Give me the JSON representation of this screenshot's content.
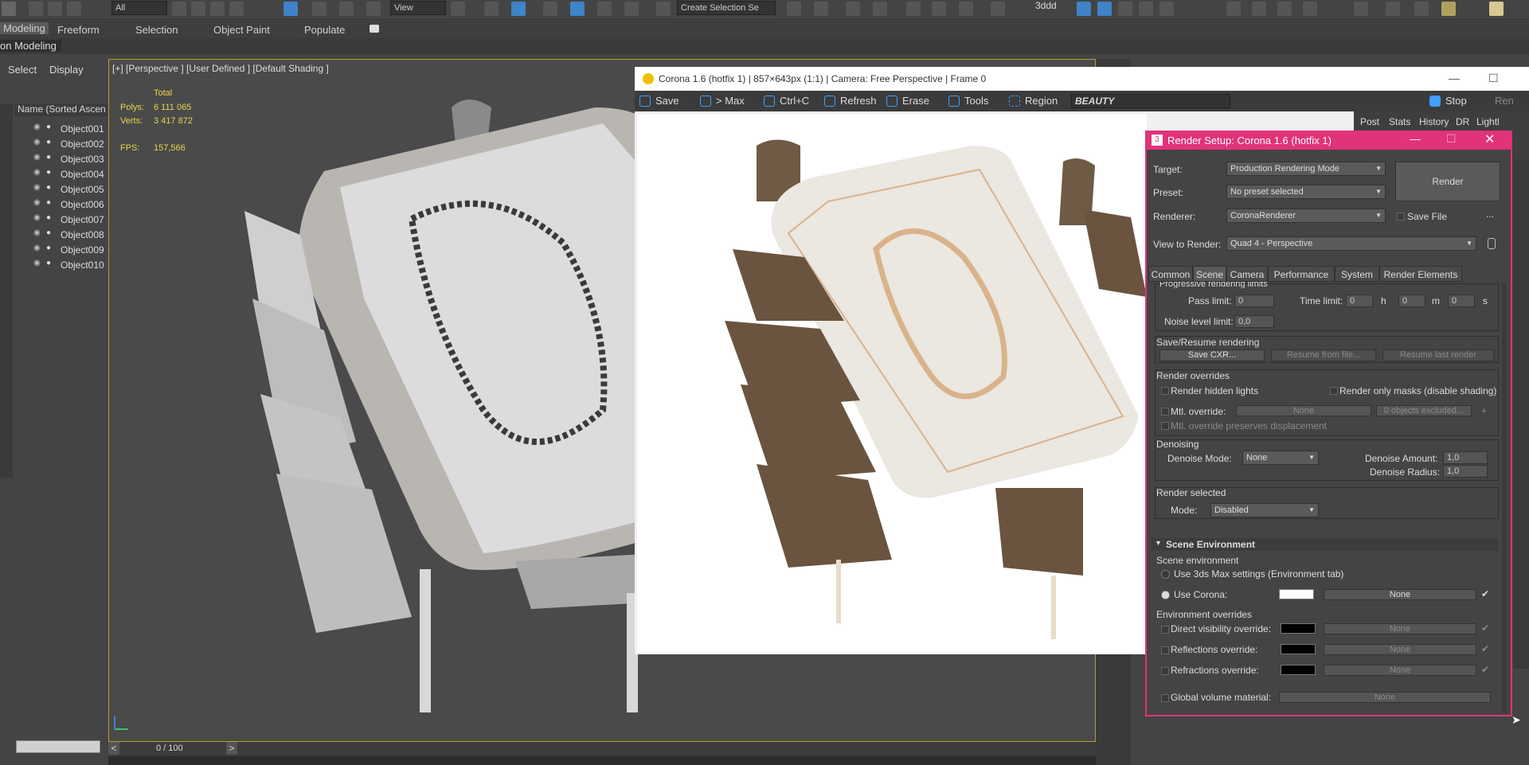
{
  "toolbar": {
    "filter_value": "All",
    "view_value": "View",
    "selection_set": "Create Selection Se",
    "user_label": "3ddd"
  },
  "ribbon": {
    "tabs": [
      "Modeling",
      "Freeform",
      "Selection",
      "Object Paint",
      "Populate"
    ],
    "sub_label": "on Modeling"
  },
  "explorer": {
    "select_label": "Select",
    "display_label": "Display",
    "column_header": "Name (Sorted Ascen",
    "objects": [
      "Object001",
      "Object002",
      "Object003",
      "Object004",
      "Object005",
      "Object006",
      "Object007",
      "Object008",
      "Object009",
      "Object010"
    ]
  },
  "viewport": {
    "label": "[+] [Perspective ] [User Defined ] [Default Shading ]",
    "stats": {
      "total": "Total",
      "polys_label": "Polys:",
      "polys": "6 111 065",
      "verts_label": "Verts:",
      "verts": "3 417 872",
      "fps_label": "FPS:",
      "fps": "157,566"
    },
    "timeline": "0 / 100"
  },
  "vfb": {
    "title": "Corona 1.6 (hotfix 1) | 857×643px (1:1) | Camera: Free Perspective | Frame 0",
    "buttons": {
      "save": "Save",
      "to_max": "> Max",
      "copy": "Ctrl+C",
      "refresh": "Refresh",
      "erase": "Erase",
      "tools": "Tools",
      "region": "Region",
      "stop": "Stop",
      "render": "Ren"
    },
    "channel": "BEAUTY",
    "side_tabs": [
      "Post",
      "Stats",
      "History",
      "DR",
      "Lightl"
    ]
  },
  "render_setup": {
    "title": "Render Setup: Corona 1.6 (hotfix 1)",
    "target_label": "Target:",
    "target": "Production Rendering Mode",
    "preset_label": "Preset:",
    "preset": "No preset selected",
    "renderer_label": "Renderer:",
    "renderer": "CoronaRenderer",
    "save_file": "Save File",
    "more": "...",
    "view_label": "View to Render:",
    "view": "Quad 4 - Perspective",
    "render_button": "Render",
    "tabs": [
      "Common",
      "Scene",
      "Camera",
      "Performance",
      "System",
      "Render Elements"
    ],
    "progressive": {
      "header": "Progressive rendering limits",
      "pass_label": "Pass limit:",
      "pass": "0",
      "time_label": "Time limit:",
      "h_val": "0",
      "h": "h",
      "m_val": "0",
      "m": "m",
      "s_val": "0",
      "s": "s",
      "noise_label": "Noise level limit:",
      "noise": "0,0"
    },
    "save_resume": {
      "header": "Save/Resume rendering",
      "save": "Save CXR...",
      "resume_file": "Resume from file...",
      "resume_last": "Resume last render"
    },
    "overrides": {
      "header": "Render overrides",
      "hidden_lights": "Render hidden lights",
      "only_masks": "Render only masks (disable shading)",
      "mtl_override": "Mtl. override:",
      "mtl_none": "None",
      "excluded": "0 objects excluded...",
      "plus": "+",
      "preserve": "Mtl. override preserves displacement"
    },
    "denoising": {
      "header": "Denoising",
      "mode_label": "Denoise Mode:",
      "mode": "None",
      "amount_label": "Denoise Amount:",
      "amount": "1,0",
      "radius_label": "Denoise Radius:",
      "radius": "1,0"
    },
    "render_selected": {
      "header": "Render selected",
      "mode_label": "Mode:",
      "mode": "Disabled"
    },
    "scene_env": {
      "rollout": "Scene Environment",
      "header": "Scene environment",
      "use_max": "Use 3ds Max settings (Environment tab)",
      "use_corona": "Use Corona:",
      "none": "None",
      "overrides_header": "Environment overrides",
      "direct": "Direct visibility override:",
      "reflections": "Reflections override:",
      "refractions": "Refractions override:",
      "volume": "Global volume material:"
    },
    "colors": {
      "accent": "#e0337a",
      "env_color": "#ffffff",
      "override_color": "#000000"
    }
  }
}
